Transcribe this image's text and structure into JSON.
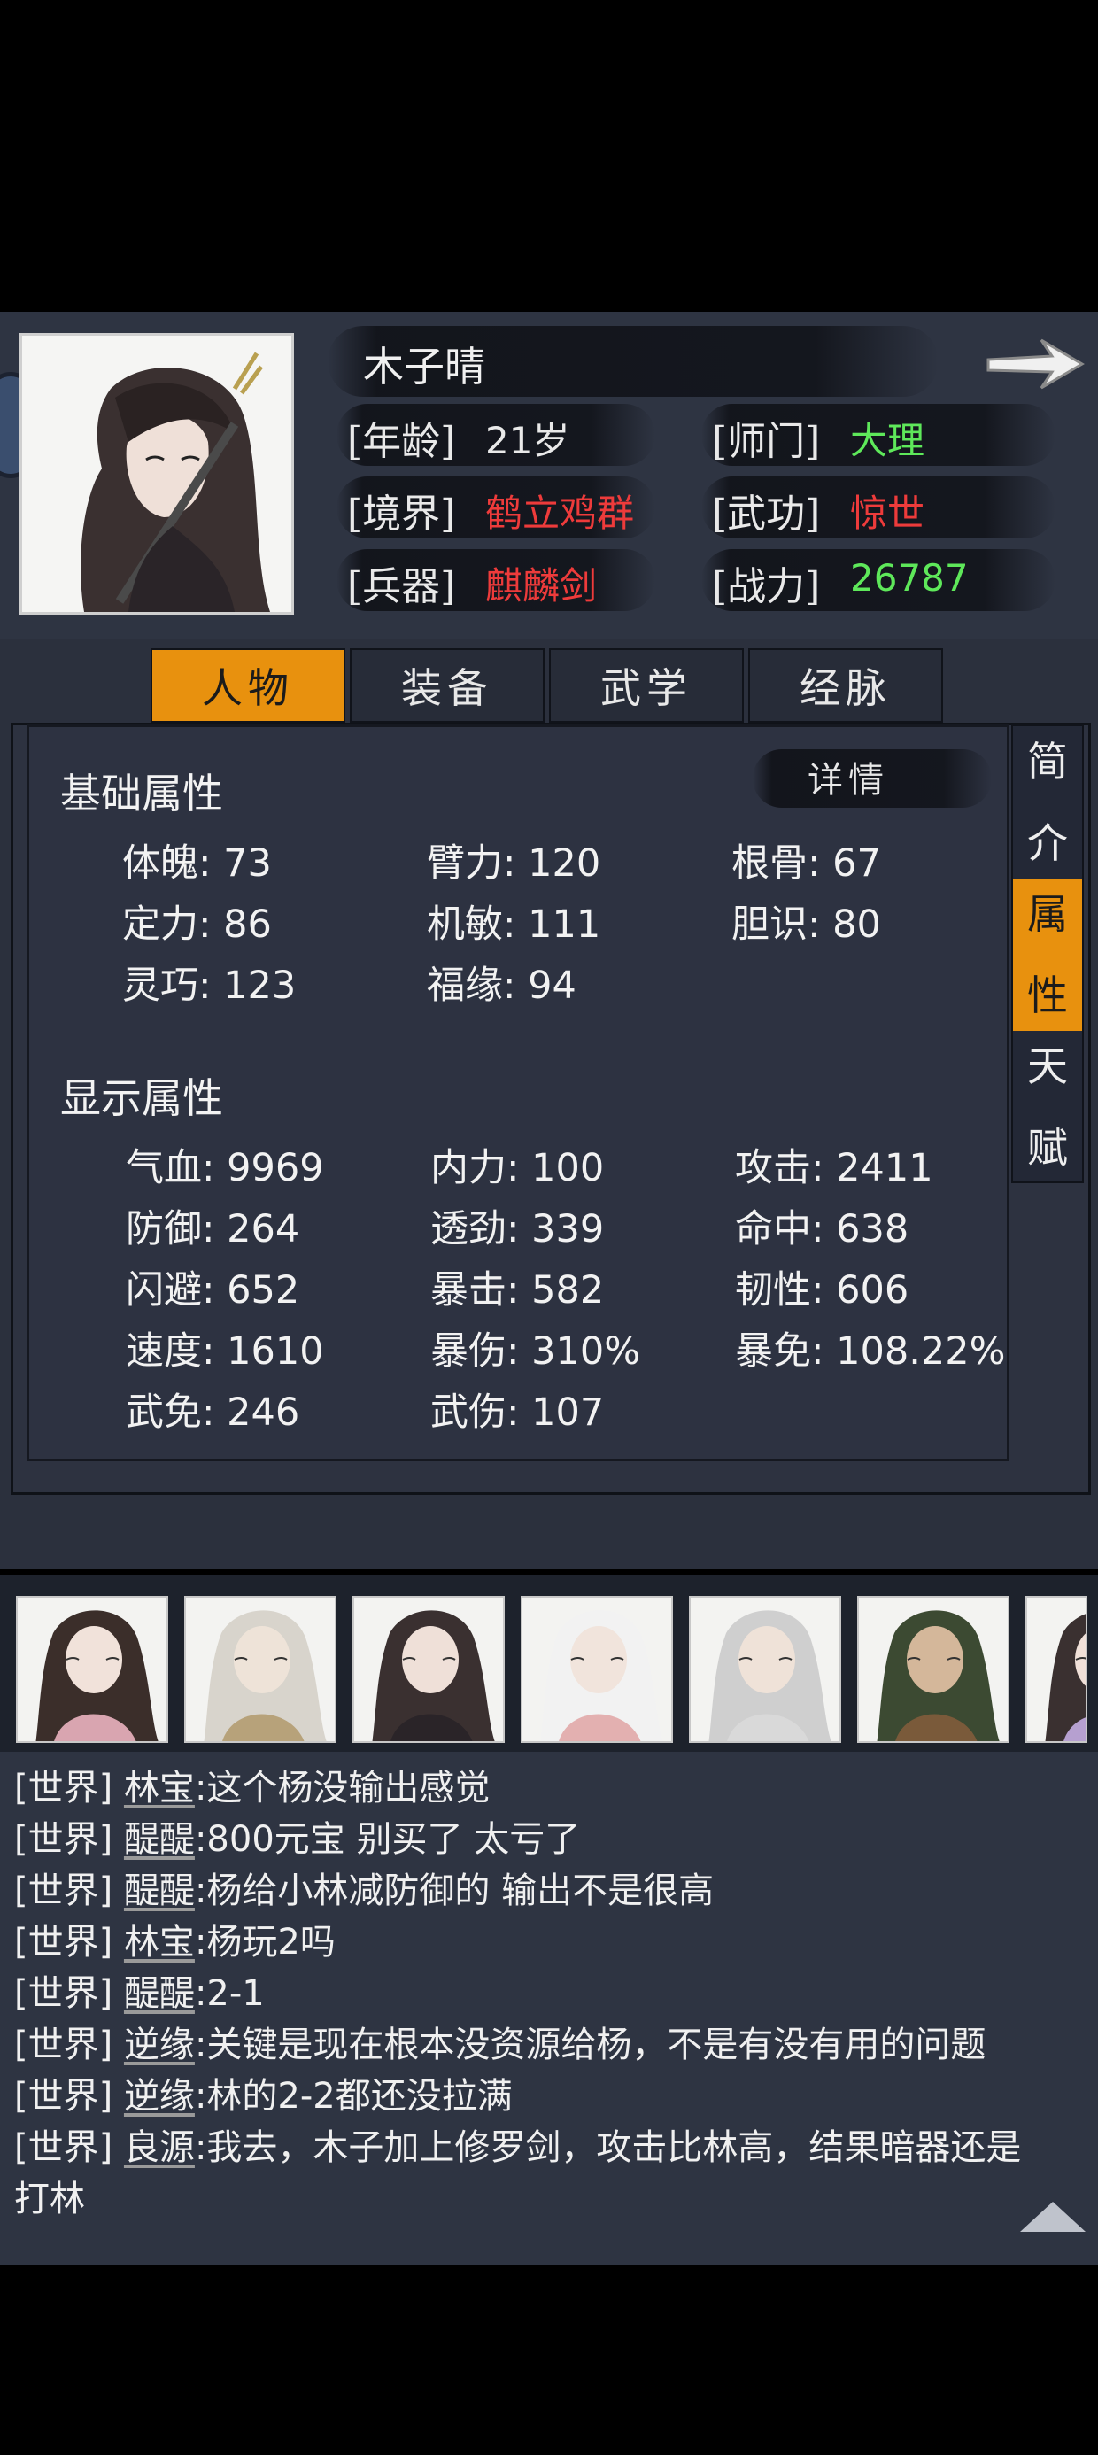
{
  "header": {
    "name": "木子晴",
    "rows": [
      [
        {
          "label": "[年龄]",
          "value": "21岁",
          "color": "#e9e9e9"
        },
        {
          "label": "[师门]",
          "value": "大理",
          "color": "#5ee85a"
        }
      ],
      [
        {
          "label": "[境界]",
          "value": "鹤立鸡群",
          "color": "#ee3b3b"
        },
        {
          "label": "[武功]",
          "value": "惊世",
          "color": "#ee3b3b"
        }
      ],
      [
        {
          "label": "[兵器]",
          "value": "麒麟剑",
          "color": "#ee3b3b"
        },
        {
          "label": "[战力]",
          "value": "26787",
          "color": "#5ee85a"
        }
      ]
    ],
    "next_icon": "arrow-right-icon"
  },
  "tabs": [
    "人物",
    "装备",
    "武学",
    "经脉"
  ],
  "active_tab": 0,
  "detail_label": "详情",
  "side_tabs": [
    {
      "line1": "简",
      "line2": "介"
    },
    {
      "line1": "属",
      "line2": "性"
    },
    {
      "line1": "天",
      "line2": "赋"
    }
  ],
  "active_side_tab": 1,
  "basic": {
    "title": "基础属性",
    "stats": [
      "体魄: 73",
      "臂力: 120",
      "根骨: 67",
      "定力: 86",
      "机敏: 111",
      "胆识: 80",
      "灵巧: 123",
      "福缘: 94"
    ]
  },
  "display": {
    "title": "显示属性",
    "stats": [
      "气血: 9969",
      "内力: 100",
      "攻击: 2411",
      "防御: 264",
      "透劲: 339",
      "命中: 638",
      "闪避: 652",
      "暴击: 582",
      "韧性: 606",
      "速度: 1610",
      "暴伤: 310%",
      "暴免: 108.22%",
      "武免: 246",
      "武伤: 107"
    ]
  },
  "chat": [
    {
      "channel": "[世界]",
      "user": "林宝",
      "text": ":这个杨没输出感觉"
    },
    {
      "channel": "[世界]",
      "user": "醍醍",
      "text": ":800元宝 别买了 太亏了"
    },
    {
      "channel": "[世界]",
      "user": "醍醍",
      "text": ":杨给小林减防御的 输出不是很高"
    },
    {
      "channel": "[世界]",
      "user": "林宝",
      "text": ":杨玩2吗"
    },
    {
      "channel": "[世界]",
      "user": "醍醍",
      "text": ":2-1"
    },
    {
      "channel": "[世界]",
      "user": "逆缘",
      "text": ":关键是现在根本没资源给杨，不是有没有用的问题"
    },
    {
      "channel": "[世界]",
      "user": "逆缘",
      "text": ":林的2-2都还没拉满"
    },
    {
      "channel": "[世界]",
      "user": "良源",
      "text": ":我去，木子加上修罗剑，攻击比林高，结果暗器还是"
    },
    {
      "channel": "",
      "user": "",
      "text": "打林"
    }
  ],
  "colors": {
    "accent": "#e8910e",
    "green": "#5ee85a",
    "red": "#ee3b3b",
    "panel": "#2e3442"
  }
}
